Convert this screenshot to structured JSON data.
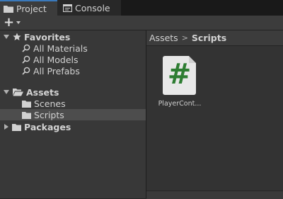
{
  "tabs": [
    {
      "label": "Project",
      "icon": "folder-icon",
      "active": true
    },
    {
      "label": "Console",
      "icon": "console-icon",
      "active": false
    }
  ],
  "toolbar": {
    "add_label": "+"
  },
  "tree": {
    "favorites": {
      "label": "Favorites",
      "items": [
        {
          "label": "All Materials"
        },
        {
          "label": "All Models"
        },
        {
          "label": "All Prefabs"
        }
      ]
    },
    "assets": {
      "label": "Assets",
      "items": [
        {
          "label": "Scenes"
        },
        {
          "label": "Scripts",
          "selected": true
        }
      ]
    },
    "packages": {
      "label": "Packages"
    }
  },
  "breadcrumb": {
    "items": [
      "Assets",
      "Scripts"
    ],
    "separator": ">"
  },
  "files": [
    {
      "name": "PlayerCont...",
      "icon": "csharp-script-icon",
      "glyph": "#"
    }
  ],
  "colors": {
    "accent": "#3a79bb",
    "script_glyph": "#2e7d32",
    "selected_row": "#4d4d4d"
  }
}
